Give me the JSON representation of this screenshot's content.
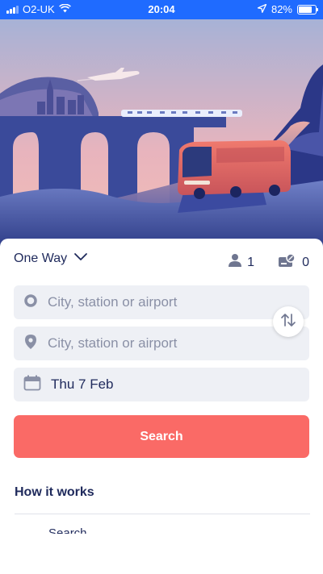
{
  "status_bar": {
    "carrier": "O2-UK",
    "time": "20:04",
    "battery_percent": "82%",
    "battery_level": 0.82,
    "icons": [
      "signal-icon",
      "wifi-icon",
      "location-arrow-icon",
      "battery-icon"
    ]
  },
  "hero": {
    "icon": "illustration-bus-train-plane",
    "colors": {
      "sky_top": "#a8b4d8",
      "sky_bottom": "#f2b8b4",
      "land": "#2a3a8c",
      "bus": "#e86a62"
    }
  },
  "search": {
    "trip_type": "One Way",
    "passengers": "1",
    "discounts": "0",
    "from_placeholder": "City, station or airport",
    "to_placeholder": "City, station or airport",
    "date": "Thu 7 Feb",
    "search_label": "Search"
  },
  "how_it_works": {
    "title": "How it works",
    "peek": "Search"
  },
  "colors": {
    "accent": "#1f6bff",
    "cta": "#fa6a66",
    "text": "#1f2a5c",
    "field_bg": "#eef0f5"
  }
}
